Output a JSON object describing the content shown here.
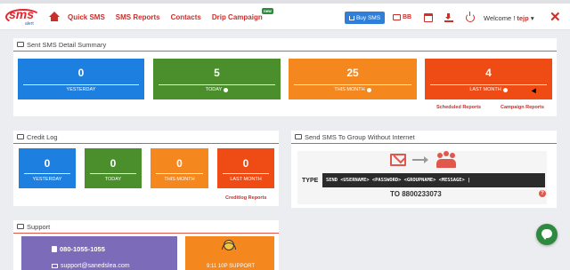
{
  "header": {
    "logo_text": "sms",
    "logo_sub": "alert",
    "nav": [
      {
        "label": "Quick SMS"
      },
      {
        "label": "SMS Reports"
      },
      {
        "label": "Contacts"
      },
      {
        "label": "Drip Campaign",
        "badge": "new"
      }
    ],
    "buy_sms_label": "Buy SMS",
    "credit_label": "BB",
    "welcome_prefix": "Welcome !",
    "username": "tejp",
    "user_caret": "▾",
    "close_glyph": "✕"
  },
  "sent_summary": {
    "title": "Sent SMS Detail Summary",
    "stats": [
      {
        "value": "0",
        "label": "YESTERDAY",
        "color": "#1d7fe0"
      },
      {
        "value": "5",
        "label": "TODAY",
        "color": "#4a8f2c"
      },
      {
        "value": "25",
        "label": "THIS MONTH",
        "color": "#f5871f"
      },
      {
        "value": "4",
        "label": "LAST MONTH",
        "color": "#ef4b14"
      }
    ],
    "links": {
      "scheduled": "Scheduled Reports",
      "campaign": "Campaign Reports"
    }
  },
  "credit_log": {
    "title": "Credit Log",
    "stats": [
      {
        "value": "0",
        "label": "YESTERDAY",
        "color": "#1d7fe0"
      },
      {
        "value": "0",
        "label": "TODAY",
        "color": "#4a8f2c"
      },
      {
        "value": "0",
        "label": "THIS MONTH",
        "color": "#f5871f"
      },
      {
        "value": "0",
        "label": "LAST MONTH",
        "color": "#ef4b14"
      }
    ],
    "link": "Creditlog Reports"
  },
  "group_sms": {
    "title": "Send SMS To Group Without Internet",
    "type_label": "TYPE",
    "command": "SEND <USERNAME> <PASSWORD> <GROUPNAME> <MESSAGE> |",
    "to_label": "TO",
    "to_number": "8800233073",
    "help_glyph": "?"
  },
  "support": {
    "title": "Support",
    "phone": "080-1055-1055",
    "email": "support@sanedslea.com",
    "hours": "9:11 10P SUPPORT",
    "colors": {
      "left": "#7b6bb8",
      "right": "#f5871f"
    }
  }
}
